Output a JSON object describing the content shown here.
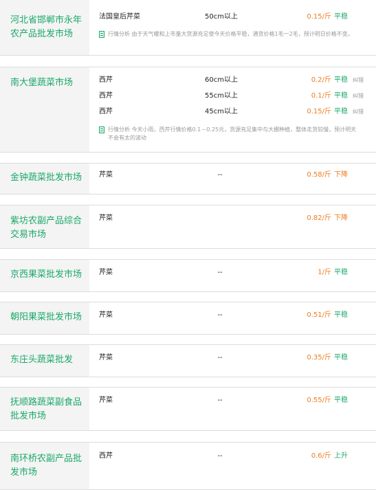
{
  "markets": [
    {
      "name": "河北省邯郸市永年农产品批发市场",
      "rows": [
        {
          "product": "法国皇后芹菜",
          "spec": "50cm以上",
          "price": "0.15/斤",
          "trend": "平稳",
          "correct": ""
        }
      ],
      "note_label": "行情分析",
      "note": "由于天气暖和上市量大货源充足使今天价格平稳，通货价格1毛一2毛，预计明日价格不变。"
    },
    {
      "name": "南大堡蔬菜市场",
      "rows": [
        {
          "product": "西芹",
          "spec": "60cm以上",
          "price": "0.2/斤",
          "trend": "平稳",
          "correct": "纠错"
        },
        {
          "product": "西芹",
          "spec": "55cm以上",
          "price": "0.1/斤",
          "trend": "平稳",
          "correct": "纠错"
        },
        {
          "product": "西芹",
          "spec": "45cm以上",
          "price": "0.15/斤",
          "trend": "平稳",
          "correct": "纠错"
        }
      ],
      "note_label": "行情分析",
      "note": "今天小雨，西芹行情价格0.1－0.25元，货源充足集中与大棚种植，整体走货较慢，预计明天不会有太的波动"
    },
    {
      "name": "金钟蔬菜批发市场",
      "rows": [
        {
          "product": "芹菜",
          "spec": "--",
          "price": "0.58/斤",
          "trend": "下降",
          "correct": ""
        }
      ]
    },
    {
      "name": "紫坊农副产品综合交易市场",
      "rows": [
        {
          "product": "芹菜",
          "spec": "",
          "price": "0.82/斤",
          "trend": "下降",
          "correct": ""
        }
      ]
    },
    {
      "name": "京西果菜批发市场",
      "rows": [
        {
          "product": "芹菜",
          "spec": "--",
          "price": "1/斤",
          "trend": "平稳",
          "correct": ""
        }
      ]
    },
    {
      "name": "朝阳果菜批发市场",
      "rows": [
        {
          "product": "芹菜",
          "spec": "--",
          "price": "0.51/斤",
          "trend": "平稳",
          "correct": ""
        }
      ]
    },
    {
      "name": "东庄头蔬菜批发",
      "rows": [
        {
          "product": "芹菜",
          "spec": "--",
          "price": "0.35/斤",
          "trend": "平稳",
          "correct": ""
        }
      ]
    },
    {
      "name": "抚顺路蔬菜副食品批发市场",
      "rows": [
        {
          "product": "芹菜",
          "spec": "--",
          "price": "0.55/斤",
          "trend": "平稳",
          "correct": ""
        }
      ]
    },
    {
      "name": "南环桥农副产品批发市场",
      "rows": [
        {
          "product": "西芹",
          "spec": "--",
          "price": "0.6/斤",
          "trend": "上升",
          "correct": ""
        }
      ]
    }
  ],
  "colors": {
    "name_green": "#1aa86a",
    "price_orange": "#f07b1e",
    "panel_bg": "#f4f4f4",
    "note_gray": "#999999"
  },
  "icons": {
    "note": "document-icon"
  }
}
